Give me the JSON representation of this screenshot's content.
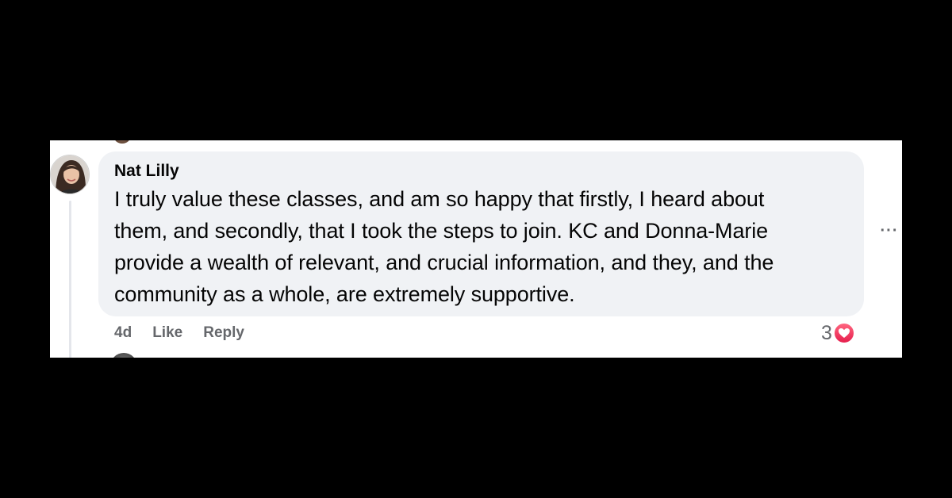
{
  "comment": {
    "author": "Nat Lilly",
    "text_lines": [
      "I truly value these classes, and am so happy that firstly, I heard about",
      "them, and secondly, that I took the steps to join. KC and Donna-Marie",
      "provide a wealth of relevant, and crucial information, and they, and the",
      "community as a whole, are extremely supportive."
    ],
    "timestamp": "4d",
    "like_label": "Like",
    "reply_label": "Reply",
    "reaction_count": "3",
    "reaction_icon": "love-icon",
    "more_icon": "more-options-icon"
  },
  "colors": {
    "background": "#000000",
    "panel": "#ffffff",
    "bubble": "#f0f2f5",
    "secondary_text": "#65676b",
    "love_reaction": "#f33e58"
  }
}
